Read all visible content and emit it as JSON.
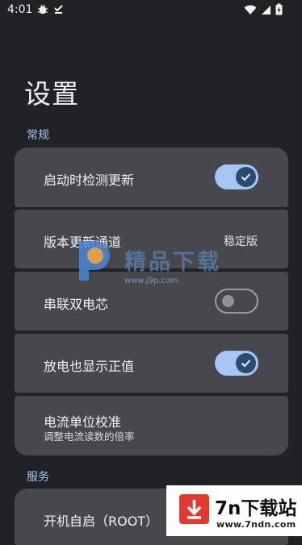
{
  "status_bar": {
    "time": "4:01"
  },
  "page": {
    "title": "设置"
  },
  "sections": {
    "general": "常规",
    "service": "服务"
  },
  "settings": {
    "check_updates": {
      "label": "启动时检测更新",
      "enabled": true
    },
    "update_channel": {
      "label": "版本更新通道",
      "value": "稳定版"
    },
    "dual_cell": {
      "label": "串联双电芯",
      "enabled": false
    },
    "positive_discharge": {
      "label": "放电也显示正值",
      "enabled": true
    },
    "current_unit": {
      "label": "电流单位校准",
      "description": "调整电流读数的倍率"
    },
    "autostart": {
      "label": "开机自启（ROOT）"
    }
  },
  "watermark": {
    "text": "精品下载",
    "url": "www.j9p.com"
  },
  "badge": {
    "title": "7n下载站",
    "url": "www.7ndn.com"
  },
  "colors": {
    "background": "#202226",
    "card": "#46484d",
    "accent": "#a7c6f5",
    "section": "#a9c7f0"
  }
}
